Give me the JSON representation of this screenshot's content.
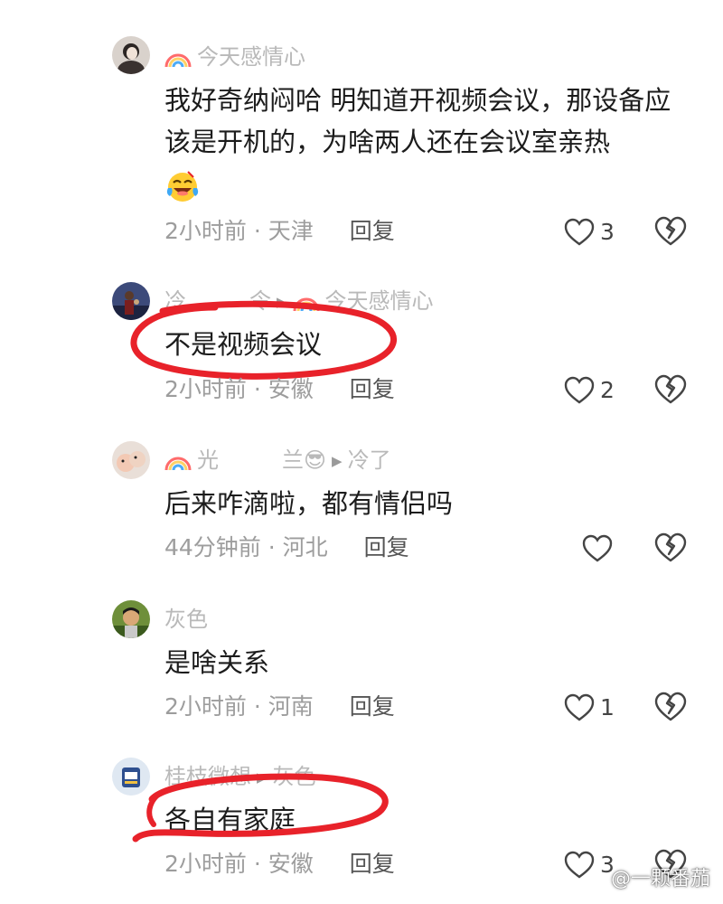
{
  "comments": [
    {
      "name": "今天感情心",
      "text": "我好奇纳闷哈 明知道开视频会议，那设备应该是开机的，为啥两人还在会议室亲热",
      "emoji": "laughing-crying-emoji",
      "time": "2小时前",
      "location": "天津",
      "reply_label": "回复",
      "likes": "3"
    },
    {
      "name": "冷",
      "name_extra": "令",
      "reply_to": "今天感情心",
      "text": "不是视频会议",
      "time": "2小时前",
      "location": "安徽",
      "reply_label": "回复",
      "likes": "2"
    },
    {
      "name": "光",
      "name_extra": "兰😎",
      "reply_to": "冷了",
      "text": "后来咋滴啦，都有情侣吗",
      "time": "44分钟前",
      "location": "河北",
      "reply_label": "回复",
      "likes": ""
    },
    {
      "name": "灰色",
      "text": "是啥关系",
      "time": "2小时前",
      "location": "河南",
      "reply_label": "回复",
      "likes": "1"
    },
    {
      "name": "桂枝微想",
      "reply_to": "灰色",
      "text": "各自有家庭",
      "time": "2小时前",
      "location": "安徽",
      "reply_label": "回复",
      "likes": "3"
    }
  ],
  "watermark": "@一颗番茄",
  "colors": {
    "marker": "#e8222a",
    "meta_text": "#9d9d9d",
    "name_text": "#b9b9b9"
  },
  "icons": {
    "like": "heart-outline-icon",
    "dislike": "broken-heart-icon",
    "reply_arrow": "play-triangle-icon"
  }
}
